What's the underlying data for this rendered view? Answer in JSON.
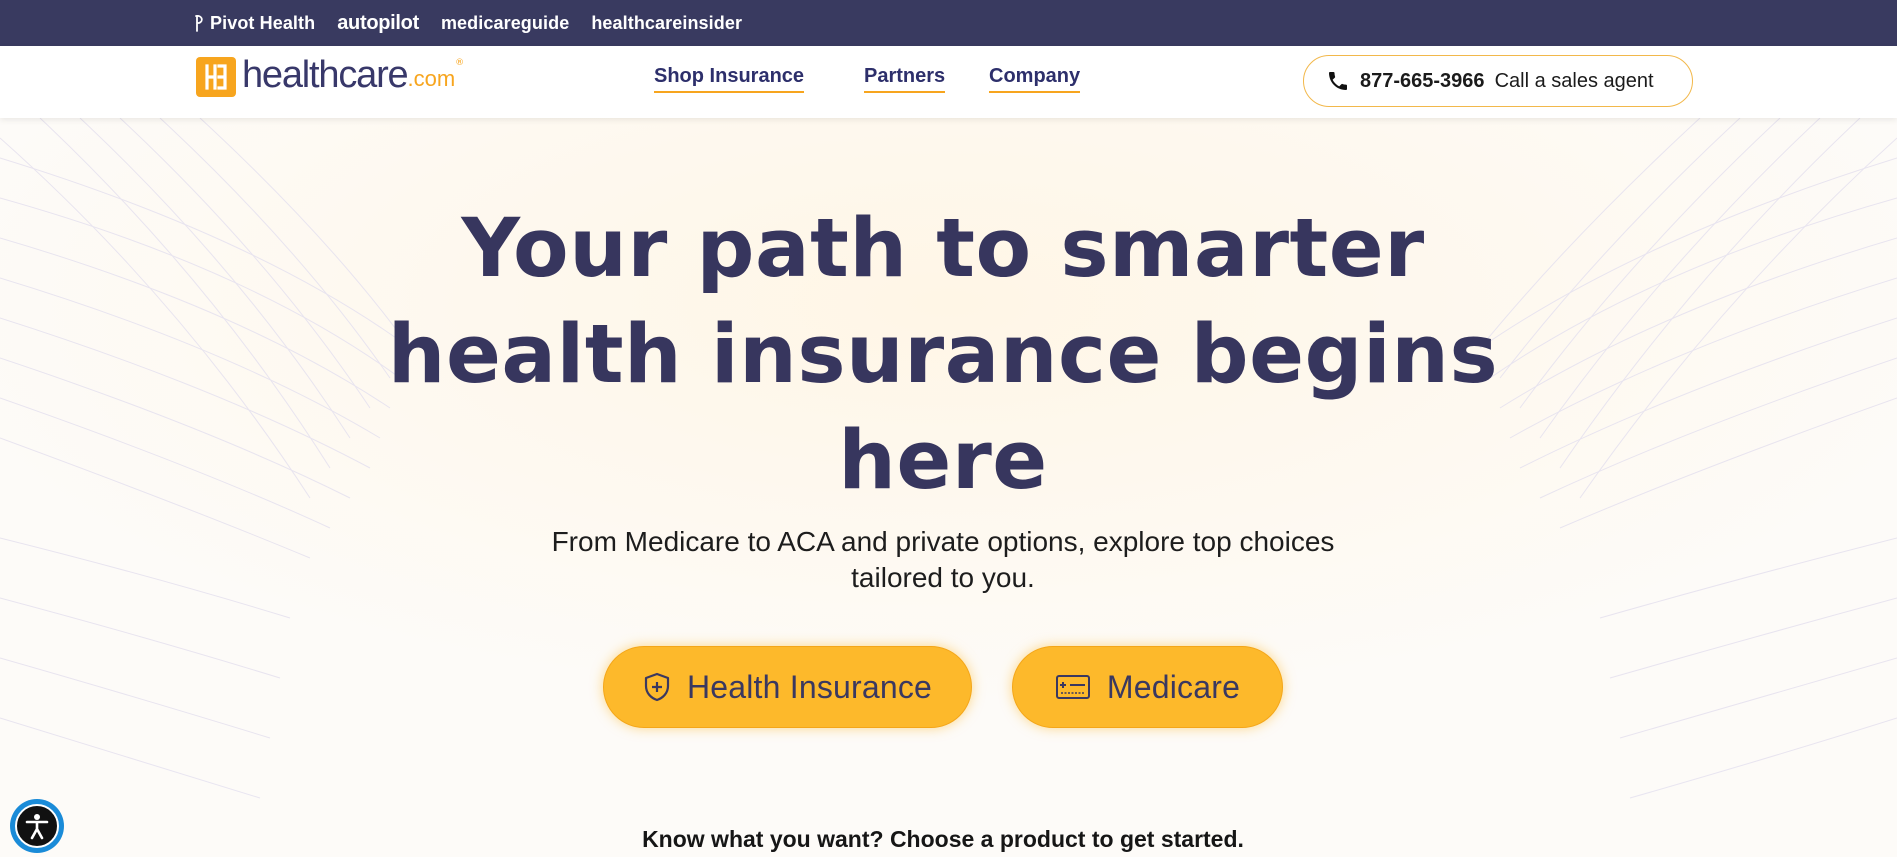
{
  "topbar": {
    "brands": [
      "Pivot Health",
      "autopilot",
      "medicareguide",
      "healthcareinsider"
    ]
  },
  "header": {
    "logo_text": "healthcare",
    "logo_suffix": ".com",
    "logo_reg": "®",
    "nav": [
      "Shop Insurance",
      "Partners",
      "Company"
    ],
    "phone_number": "877-665-3966",
    "phone_label": "Call a sales agent"
  },
  "hero": {
    "title_lines": [
      "Your path to smarter",
      "health insurance begins",
      "here"
    ],
    "subtitle_lines": [
      "From Medicare to ACA and private options, explore top choices",
      "tailored to you."
    ],
    "buttons": [
      "Health Insurance",
      "Medicare"
    ],
    "prompt": "Know what you want? Choose a product to get started."
  },
  "colors": {
    "topbar_bg": "#393a60",
    "accent": "#f7a51e",
    "cta_bg": "#fdb92b",
    "title": "#37365e"
  },
  "icons": [
    "pivot-health-icon",
    "phone-icon",
    "shield-plus-icon",
    "medicare-card-icon",
    "accessibility-icon"
  ]
}
